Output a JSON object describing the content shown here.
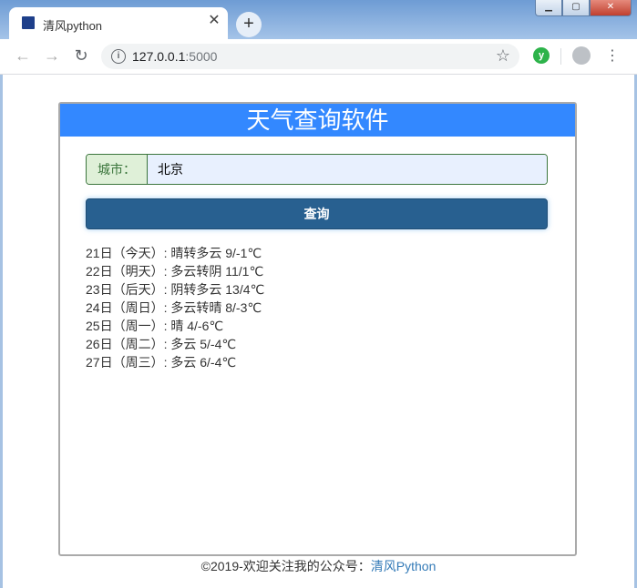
{
  "browser": {
    "tab_title": "清风python",
    "tab_close": "✕",
    "new_tab": "+",
    "url_host": "127.0.0.1",
    "url_port": ":5000",
    "window_buttons": {
      "minimize": "▁",
      "maximize": "▢",
      "close": "✕"
    }
  },
  "app": {
    "title": "天气查询软件",
    "city_label": "城市：",
    "city_value": "北京",
    "query_button": "查询",
    "forecast": [
      "21日（今天）: 晴转多云 9/-1℃",
      "22日（明天）: 多云转阴 11/1℃",
      "23日（后天）: 阴转多云 13/4℃",
      "24日（周日）: 多云转晴 8/-3℃",
      "25日（周一）: 晴 4/-6℃",
      "26日（周二）: 多云 5/-4℃",
      "27日（周三）: 多云 6/-4℃"
    ]
  },
  "footer": {
    "text": "©2019-欢迎关注我的公众号：",
    "link": "清风Python"
  },
  "icons": {
    "back": "arrow-left-icon",
    "forward": "arrow-right-icon",
    "reload": "reload-icon",
    "info": "info-icon",
    "star": "star-icon",
    "extension": "extension-icon",
    "profile": "avatar-icon",
    "menu": "kebab-menu-icon"
  },
  "colors": {
    "header": "#3388ff",
    "button": "#286090",
    "label_bg": "#dff0d8",
    "input_bg": "#e8f0fe",
    "link": "#337ab7"
  }
}
